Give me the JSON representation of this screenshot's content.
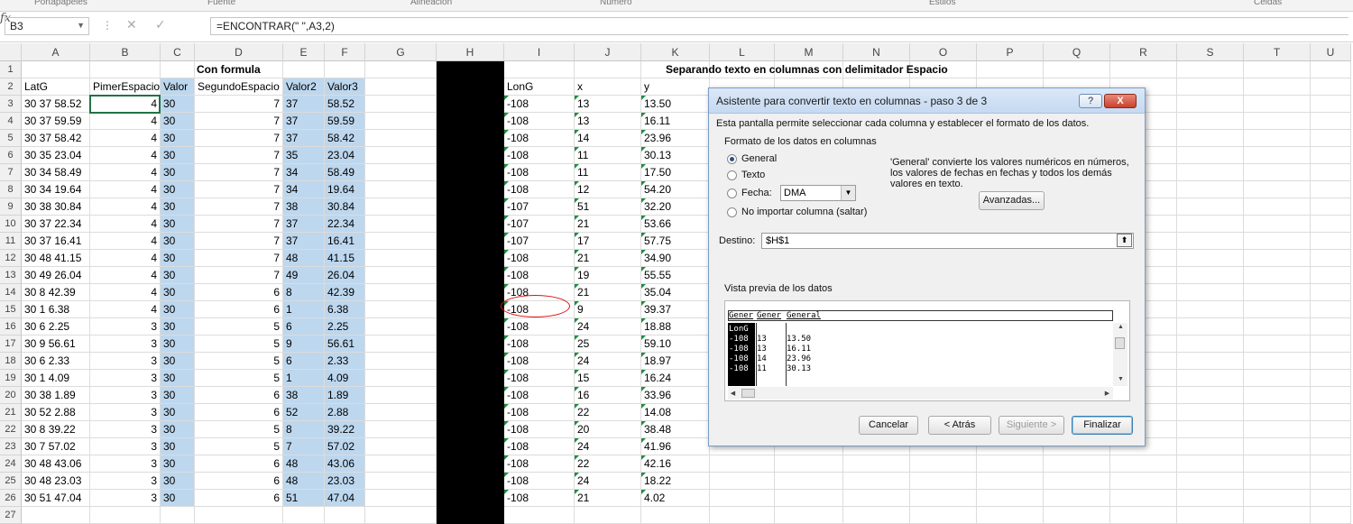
{
  "ribbon": {
    "groups": [
      "Portapapeles",
      "Fuente",
      "Alineación",
      "Número",
      "Estilos",
      "Celdas"
    ]
  },
  "formula_bar": {
    "name_box": "B3",
    "fx_label": "fx",
    "formula": "=ENCONTRAR(\" \",A3,2)"
  },
  "columns": [
    "A",
    "B",
    "C",
    "D",
    "E",
    "F",
    "G",
    "H",
    "I",
    "J",
    "K",
    "L",
    "M",
    "N",
    "O",
    "P",
    "Q",
    "R",
    "S",
    "T",
    "U"
  ],
  "sheet": {
    "title_left": "Con formula",
    "title_right": "Separando texto en columnas con delimitador  Espacio",
    "headers_left": [
      "LatG",
      "PimerEspacio",
      "Valor",
      "SegundoEspacio",
      "Valor2",
      "Valor3"
    ],
    "headers_right": [
      "LonG",
      "x",
      "y"
    ],
    "rows": [
      [
        "30 37 58.52",
        "4",
        "30",
        "7",
        "37",
        "58.52",
        "-108",
        "13",
        "13.50"
      ],
      [
        "30 37 59.59",
        "4",
        "30",
        "7",
        "37",
        "59.59",
        "-108",
        "13",
        "16.11"
      ],
      [
        "30 37 58.42",
        "4",
        "30",
        "7",
        "37",
        "58.42",
        "-108",
        "14",
        "23.96"
      ],
      [
        "30 35 23.04",
        "4",
        "30",
        "7",
        "35",
        "23.04",
        "-108",
        "11",
        "30.13"
      ],
      [
        "30 34 58.49",
        "4",
        "30",
        "7",
        "34",
        "58.49",
        "-108",
        "11",
        "17.50"
      ],
      [
        "30 34 19.64",
        "4",
        "30",
        "7",
        "34",
        "19.64",
        "-108",
        "12",
        "54.20"
      ],
      [
        "30 38 30.84",
        "4",
        "30",
        "7",
        "38",
        "30.84",
        "-107",
        "51",
        "32.20"
      ],
      [
        "30 37 22.34",
        "4",
        "30",
        "7",
        "37",
        "22.34",
        "-107",
        "21",
        "53.66"
      ],
      [
        "30 37 16.41",
        "4",
        "30",
        "7",
        "37",
        "16.41",
        "-107",
        "17",
        "57.75"
      ],
      [
        "30 48 41.15",
        "4",
        "30",
        "7",
        "48",
        "41.15",
        "-108",
        "21",
        "34.90"
      ],
      [
        "30 49 26.04",
        "4",
        "30",
        "7",
        "49",
        "26.04",
        "-108",
        "19",
        "55.55"
      ],
      [
        "30 8 42.39",
        "4",
        "30",
        "6",
        "8",
        "42.39",
        "-108",
        "21",
        "35.04"
      ],
      [
        "30 1 6.38",
        "4",
        "30",
        "6",
        "1",
        "6.38",
        "-108",
        "9",
        "39.37"
      ],
      [
        "30 6 2.25",
        "3",
        "30",
        "5",
        "6",
        "2.25",
        "-108",
        "24",
        "18.88"
      ],
      [
        "30 9 56.61",
        "3",
        "30",
        "5",
        "9",
        "56.61",
        "-108",
        "25",
        "59.10"
      ],
      [
        "30 6 2.33",
        "3",
        "30",
        "5",
        "6",
        "2.33",
        "-108",
        "24",
        "18.97"
      ],
      [
        "30 1 4.09",
        "3",
        "30",
        "5",
        "1",
        "4.09",
        "-108",
        "15",
        "16.24"
      ],
      [
        "30 38 1.89",
        "3",
        "30",
        "6",
        "38",
        "1.89",
        "-108",
        "16",
        "33.96"
      ],
      [
        "30 52 2.88",
        "3",
        "30",
        "6",
        "52",
        "2.88",
        "-108",
        "22",
        "14.08"
      ],
      [
        "30 8 39.22",
        "3",
        "30",
        "5",
        "8",
        "39.22",
        "-108",
        "20",
        "38.48"
      ],
      [
        "30 7 57.02",
        "3",
        "30",
        "5",
        "7",
        "57.02",
        "-108",
        "24",
        "41.96"
      ],
      [
        "30 48 43.06",
        "3",
        "30",
        "6",
        "48",
        "43.06",
        "-108",
        "22",
        "42.16"
      ],
      [
        "30 48 23.03",
        "3",
        "30",
        "6",
        "48",
        "23.03",
        "-108",
        "24",
        "18.22"
      ],
      [
        "30 51 47.04",
        "3",
        "30",
        "6",
        "51",
        "47.04",
        "-108",
        "21",
        "4.02"
      ]
    ]
  },
  "dialog": {
    "title": "Asistente para convertir texto en columnas - paso 3 de 3",
    "help_label": "?",
    "close_label": "X",
    "description": "Esta pantalla permite seleccionar cada columna y establecer el formato de los datos.",
    "format_group_label": "Formato de los datos en columnas",
    "options": [
      "General",
      "Texto",
      "Fecha:",
      "No importar columna (saltar)"
    ],
    "selected_option": "General",
    "date_format": "DMA",
    "info_text": [
      "'General' convierte los valores numéricos en números,",
      "los valores de fechas en fechas y todos los demás",
      "valores en texto."
    ],
    "advanced_label": "Avanzadas...",
    "destination_label": "Destino:",
    "destination_value": "$H$1",
    "preview_label": "Vista previa de los datos",
    "preview_headers": [
      "Gener",
      "Gener",
      "General"
    ],
    "preview_rows": [
      [
        "LonG",
        "",
        ""
      ],
      [
        "-108",
        "13",
        "13.50"
      ],
      [
        "-108",
        "13",
        "16.11"
      ],
      [
        "-108",
        "14",
        "23.96"
      ],
      [
        "-108",
        "11",
        "30.13"
      ]
    ],
    "buttons": {
      "cancel": "Cancelar",
      "back": "< Atrás",
      "next": "Siguiente >",
      "finish": "Finalizar"
    }
  },
  "colors": {
    "accent_blue": "#bdd7ee",
    "annotation_red": "#e01010",
    "grid": "#dcdcdc"
  }
}
